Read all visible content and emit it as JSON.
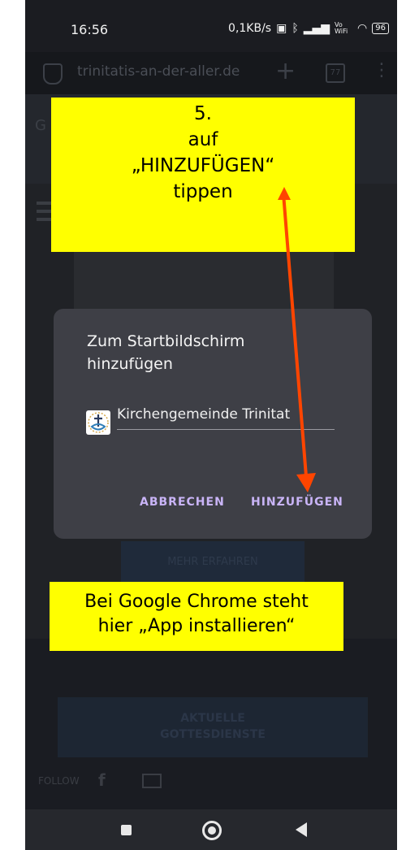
{
  "status_bar": {
    "time": "16:56",
    "right": "0,1KB/s",
    "signal": "Vo WiFi",
    "battery": "96"
  },
  "browser": {
    "url": "trinitatis-an-der-aller.de",
    "tabs_count": "77",
    "background_button": "MEHR ERFAHREN",
    "services_button_line1": "AKTUELLE",
    "services_button_line2": "GOTTESDIENSTE",
    "follow_label": "FOLLOW",
    "page_initial": "G"
  },
  "dialog": {
    "title": "Zum Startbildschirm hinzufügen",
    "app_name": "Kirchengemeinde Trinitat",
    "cancel_label": "ABBRECHEN",
    "add_label": "HINZUFÜGEN"
  },
  "callout_top": {
    "line1": "5.",
    "line2": "auf",
    "line3": "„HINZUFÜGEN“",
    "line4": "tippen"
  },
  "callout_bottom": {
    "line1": "Bei Google Chrome steht",
    "line2": "hier „App installieren“"
  },
  "colors": {
    "callout": "#ffff00",
    "arrow": "#ff4500",
    "dialog_bg": "#3e3f46",
    "accent": "#c9b4f7"
  }
}
